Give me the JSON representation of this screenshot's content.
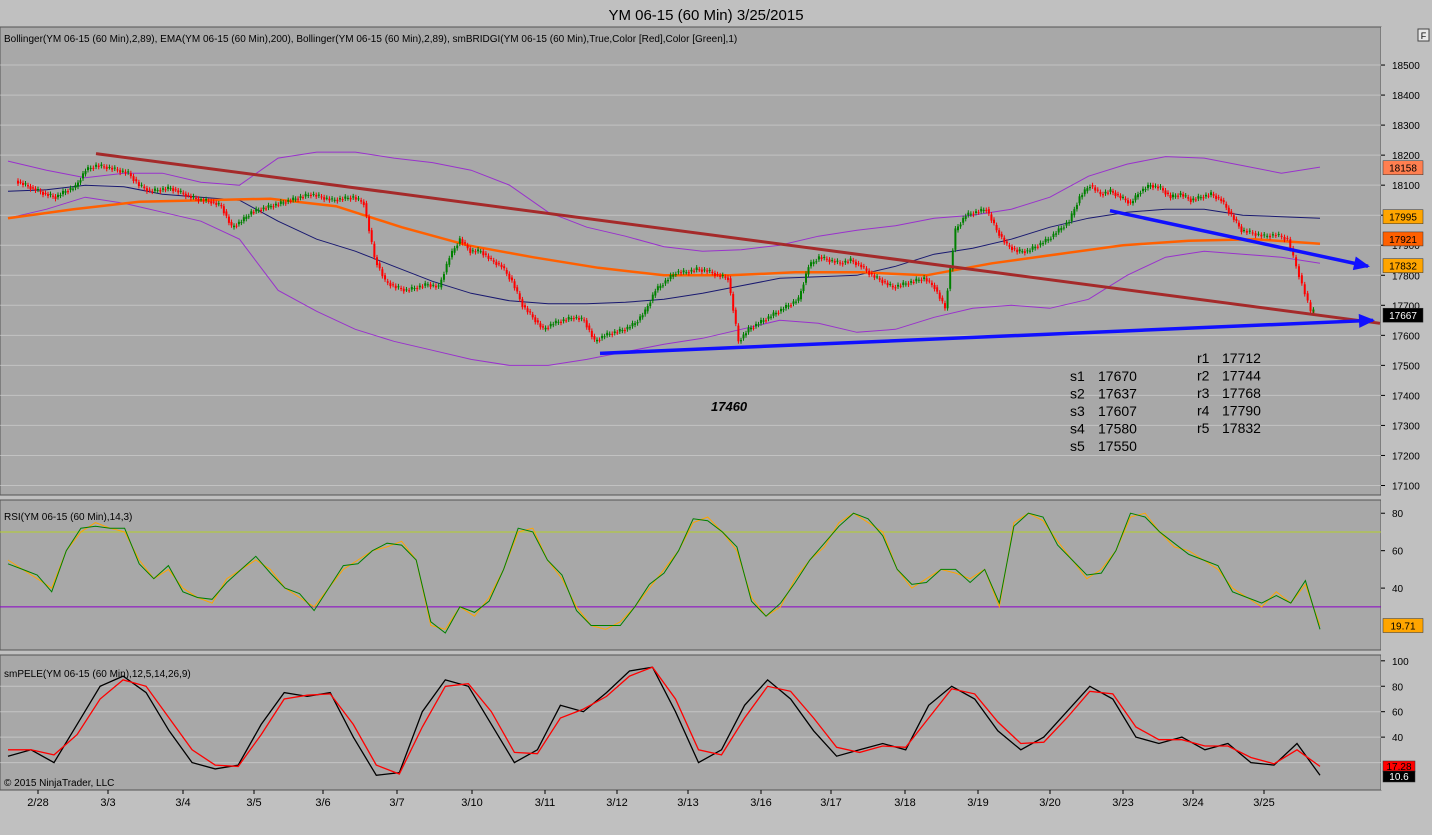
{
  "window_title": "YM 06-15 (60 Min)  3/25/2015",
  "f_button": "F",
  "copyright": "© 2015 NinjaTrader, LLC",
  "colors": {
    "background": "#c0c0c0",
    "panel": "#a8a8a8",
    "up_candle": "#008000",
    "down_candle": "#ff0000",
    "ema": "#ff6000",
    "bollinger_outer": "#9932cc",
    "bollinger_mid": "#191970",
    "trendline_red": "#a52a2a",
    "trendline_blue": "#1010ff",
    "rsi_line": "#008000",
    "rsi_avg": "#ffa500",
    "pele_k": "#000000",
    "pele_d": "#ff0000"
  },
  "chart_data": [
    {
      "type": "line",
      "panel": "price",
      "indicator_label": "Bollinger(YM 06-15 (60 Min),2,89), EMA(YM 06-15 (60 Min),200), Bollinger(YM 06-15 (60 Min),2,89), smBRIDGI(YM 06-15 (60 Min),True,Color [Red],Color [Green],1)",
      "ylim": [
        17075,
        18620
      ],
      "y_ticks": [
        18500,
        18400,
        18300,
        18200,
        18100,
        18000,
        17900,
        17800,
        17700,
        17600,
        17500,
        17400,
        17300,
        17200,
        17100
      ],
      "x_tick_labels": [
        "2/28",
        "3/3",
        "3/4",
        "3/5",
        "3/6",
        "3/7",
        "3/10",
        "3/11",
        "3/12",
        "3/13",
        "3/16",
        "3/17",
        "3/18",
        "3/19",
        "3/20",
        "3/23",
        "3/24",
        "3/25"
      ],
      "price_series": [
        {
          "session": "2/28",
          "values": [
            18115,
            18100,
            18085,
            18070,
            18060,
            18080,
            18095
          ]
        },
        {
          "session": "3/3",
          "values": [
            18150,
            18165,
            18160,
            18150,
            18140,
            18100,
            18080
          ]
        },
        {
          "session": "3/4",
          "values": [
            18085,
            18090,
            18075,
            18060,
            18050,
            18045,
            18030
          ]
        },
        {
          "session": "3/5",
          "values": [
            17960,
            17980,
            18010,
            18020,
            18030,
            18040,
            18050
          ]
        },
        {
          "session": "3/6",
          "values": [
            18060,
            18070,
            18060,
            18050,
            18055,
            18060,
            18040
          ]
        },
        {
          "session": "3/7",
          "values": [
            17860,
            17780,
            17760,
            17750,
            17760,
            17770,
            17760
          ]
        },
        {
          "session": "3/10",
          "values": [
            17860,
            17920,
            17880,
            17880,
            17850,
            17830,
            17780
          ]
        },
        {
          "session": "3/11",
          "values": [
            17700,
            17660,
            17620,
            17640,
            17650,
            17660,
            17650
          ]
        },
        {
          "session": "3/12",
          "values": [
            17580,
            17600,
            17610,
            17620,
            17640,
            17680,
            17750
          ]
        },
        {
          "session": "3/13",
          "values": [
            17780,
            17810,
            17810,
            17820,
            17815,
            17800,
            17790
          ]
        },
        {
          "session": "3/16",
          "values": [
            17580,
            17620,
            17640,
            17660,
            17680,
            17700,
            17720
          ]
        },
        {
          "session": "3/17",
          "values": [
            17830,
            17860,
            17850,
            17840,
            17850,
            17830,
            17800
          ]
        },
        {
          "session": "3/18",
          "values": [
            17780,
            17760,
            17770,
            17780,
            17790,
            17760,
            17690
          ]
        },
        {
          "session": "3/19",
          "values": [
            17950,
            18000,
            18010,
            18020,
            17950,
            17900,
            17880
          ]
        },
        {
          "session": "3/20",
          "values": [
            17880,
            17900,
            17920,
            17950,
            17980,
            18060,
            18100
          ]
        },
        {
          "session": "3/23",
          "values": [
            18070,
            18080,
            18060,
            18040,
            18080,
            18100,
            18090
          ]
        },
        {
          "session": "3/24",
          "values": [
            18060,
            18070,
            18050,
            18060,
            18070,
            18050,
            18000
          ]
        },
        {
          "session": "3/25",
          "values": [
            17950,
            17940,
            17930,
            17935,
            17920,
            17800,
            17680
          ]
        }
      ],
      "overlays": {
        "ema200": [
          17990,
          18020,
          18045,
          18050,
          18055,
          18030,
          17960,
          17900,
          17860,
          17825,
          17800,
          17800,
          17810,
          17810,
          17800,
          17840,
          17870,
          17900,
          17915,
          17920,
          17905
        ],
        "bb_upper": [
          18180,
          18150,
          18125,
          18140,
          18140,
          18110,
          18100,
          18190,
          18210,
          18210,
          18190,
          18175,
          18150,
          18100,
          18010,
          17960,
          17930,
          17895,
          17880,
          17885,
          17900,
          17930,
          17950,
          17965,
          17990,
          18000,
          18020,
          18060,
          18130,
          18170,
          18195,
          18190,
          18165,
          18140,
          18160
        ],
        "bb_mid": [
          18080,
          18085,
          18100,
          18095,
          18070,
          18060,
          18050,
          17980,
          17920,
          17880,
          17830,
          17780,
          17740,
          17715,
          17705,
          17705,
          17710,
          17720,
          17740,
          17765,
          17790,
          17795,
          17800,
          17830,
          17870,
          17890,
          17920,
          17960,
          17990,
          18010,
          18020,
          18020,
          18000,
          17995,
          17990
        ],
        "bb_lower": [
          17990,
          18020,
          18060,
          18040,
          18010,
          17980,
          17920,
          17750,
          17680,
          17620,
          17580,
          17550,
          17520,
          17500,
          17500,
          17520,
          17545,
          17570,
          17590,
          17620,
          17650,
          17640,
          17610,
          17620,
          17660,
          17690,
          17700,
          17690,
          17720,
          17800,
          17860,
          17880,
          17870,
          17860,
          17840
        ]
      },
      "trendlines": [
        {
          "color": "trendline_red",
          "from": {
            "session": "3/2",
            "value": 18205
          },
          "to": {
            "session": "3/25",
            "value": 17640
          }
        },
        {
          "color": "trendline_blue",
          "from": {
            "session": "3/11",
            "value": 17540
          },
          "to": {
            "session": "3/25",
            "value": 17650
          }
        },
        {
          "color": "trendline_blue",
          "from": {
            "session": "3/20",
            "value": 18015
          },
          "to": {
            "session": "3/25",
            "value": 17830
          }
        }
      ],
      "annotation": "17460",
      "price_tags": [
        {
          "value": 18158,
          "label": "18158",
          "bg": "#ff7f50",
          "fg": "#000000"
        },
        {
          "value": 17995,
          "label": "17995",
          "bg": "#ffa500",
          "fg": "#000000"
        },
        {
          "value": 17921,
          "label": "17921",
          "bg": "#ff6000",
          "fg": "#000000"
        },
        {
          "value": 17832,
          "label": "17832",
          "bg": "#ffa500",
          "fg": "#000000"
        },
        {
          "value": 17667,
          "label": "17667",
          "bg": "#000000",
          "fg": "#ffffff"
        }
      ],
      "support_levels": [
        {
          "name": "s1",
          "value": "17670"
        },
        {
          "name": "s2",
          "value": "17637"
        },
        {
          "name": "s3",
          "value": "17607"
        },
        {
          "name": "s4",
          "value": "17580"
        },
        {
          "name": "s5",
          "value": "17550"
        }
      ],
      "resistance_levels": [
        {
          "name": "r1",
          "value": "17712"
        },
        {
          "name": "r2",
          "value": "17744"
        },
        {
          "name": "r3",
          "value": "17768"
        },
        {
          "name": "r4",
          "value": "17790"
        },
        {
          "name": "r5",
          "value": "17832"
        }
      ]
    },
    {
      "type": "line",
      "panel": "rsi",
      "indicator_label": "RSI(YM 06-15 (60 Min),14,3)",
      "ylim": [
        8,
        86
      ],
      "y_ticks": [
        80,
        60,
        40
      ],
      "reference_lines": [
        70,
        30
      ],
      "values": [
        55,
        50,
        45,
        40,
        60,
        70,
        75,
        72,
        70,
        55,
        45,
        50,
        40,
        35,
        32,
        45,
        50,
        55,
        50,
        40,
        35,
        30,
        40,
        50,
        55,
        60,
        62,
        65,
        55,
        20,
        18,
        30,
        25,
        35,
        50,
        70,
        72,
        55,
        45,
        30,
        20,
        18,
        22,
        30,
        40,
        50,
        60,
        75,
        78,
        70,
        60,
        35,
        25,
        30,
        45,
        55,
        62,
        75,
        80,
        75,
        70,
        50,
        40,
        45,
        50,
        48,
        45,
        50,
        30,
        75,
        80,
        76,
        65,
        55,
        45,
        50,
        60,
        78,
        80,
        70,
        62,
        60,
        55,
        50,
        40,
        35,
        30,
        38,
        32,
        42,
        20
      ],
      "last_value_label": "19.71"
    },
    {
      "type": "line",
      "panel": "pele",
      "indicator_label": "smPELE(YM 06-15 (60 Min),12,5,14,26,9)",
      "ylim": [
        0,
        103
      ],
      "y_ticks": [
        100,
        80,
        60,
        40
      ],
      "k_values": [
        25,
        30,
        20,
        50,
        80,
        88,
        75,
        45,
        20,
        15,
        18,
        50,
        75,
        72,
        75,
        40,
        10,
        12,
        60,
        85,
        80,
        50,
        20,
        30,
        65,
        60,
        75,
        92,
        95,
        60,
        20,
        30,
        65,
        85,
        70,
        45,
        25,
        30,
        35,
        30,
        65,
        80,
        70,
        45,
        30,
        40,
        60,
        80,
        70,
        40,
        35,
        40,
        30,
        35,
        20,
        18,
        35,
        10
      ],
      "d_values": [
        30,
        30,
        26,
        42,
        70,
        85,
        80,
        55,
        30,
        18,
        17,
        42,
        70,
        73,
        74,
        50,
        18,
        11,
        48,
        80,
        82,
        60,
        28,
        27,
        55,
        62,
        72,
        88,
        95,
        70,
        30,
        26,
        55,
        80,
        76,
        55,
        32,
        28,
        33,
        32,
        55,
        78,
        74,
        52,
        35,
        36,
        55,
        76,
        74,
        48,
        38,
        38,
        33,
        33,
        24,
        19,
        30,
        17
      ],
      "labels": [
        {
          "text": "17.28",
          "bg": "#ff0000",
          "fg": "#000000"
        },
        {
          "text": "10.6",
          "bg": "#000000",
          "fg": "#ffffff"
        }
      ]
    }
  ]
}
